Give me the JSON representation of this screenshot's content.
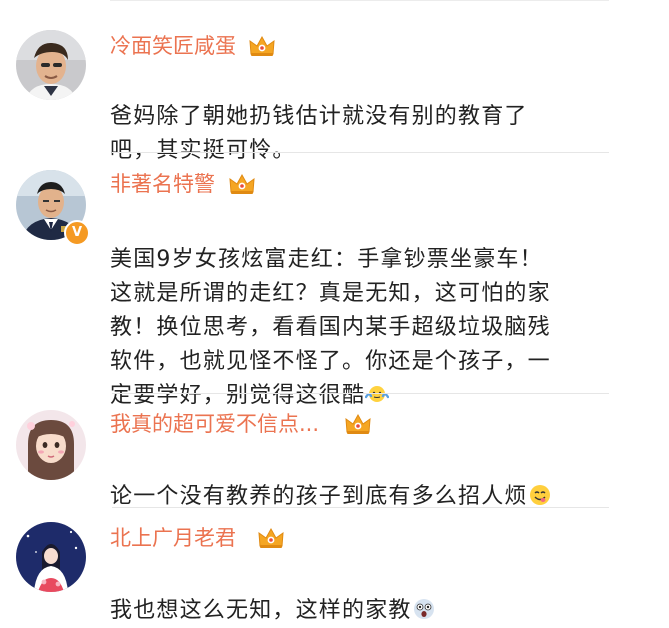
{
  "comments": [
    {
      "username": "冷面笑匠咸蛋",
      "text": "爸妈除了朝她扔钱估计就没有别的教育了\n吧，其实挺可怜。",
      "avatar_icon": "man-portrait-avatar"
    },
    {
      "username": "非著名特警",
      "text": "美国9岁女孩炫富走红：手拿钞票坐豪车！\n这就是所谓的走红？真是无知，这可怕的家\n教！换位思考，看看国内某手超级垃圾脑残\n软件，也就见怪不怪了。你还是个孩子，一\n定要学好，别觉得这很酷",
      "avatar_icon": "police-officer-avatar",
      "verified_badge": "V",
      "emoji": "shrug-emoji"
    },
    {
      "username": "我真的超可爱不信点...",
      "text": "论一个没有教养的孩子到底有多么招人烦",
      "avatar_icon": "girl-portrait-avatar",
      "emoji": "yummy-face-emoji"
    },
    {
      "username": "北上广月老君",
      "text": "我也想这么无知，这样的家教",
      "avatar_icon": "illustrated-girl-avatar",
      "emoji": "shocked-face-emoji"
    }
  ],
  "colors": {
    "username": "#eb7350",
    "text": "#222222",
    "crown": "#f5a623"
  }
}
